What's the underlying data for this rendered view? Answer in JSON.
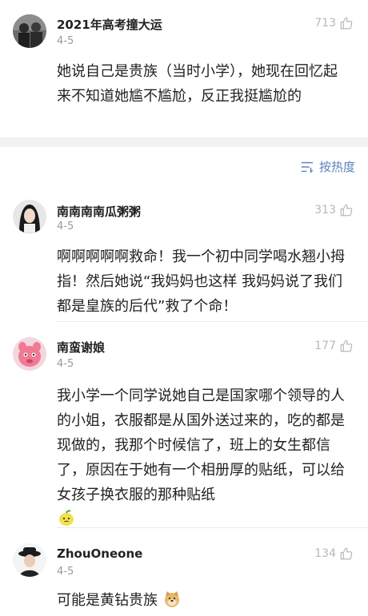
{
  "comments": [
    {
      "username": "2021年高考撞大运",
      "date": "4-5",
      "likes": "713",
      "text": "她说自己是贵族（当时小学），她现在回忆起来不知道她尴不尴尬，反正我挺尴尬的",
      "avatar": "two-people-photo-avatar"
    },
    {
      "username": "南南南南瓜粥粥",
      "date": "4-5",
      "likes": "313",
      "text": "啊啊啊啊啊救命！我一个初中同学喝水翘小拇指！然后她说“我妈妈也这样 我妈妈说了我们都是皇族的后代”救了个命！",
      "avatar": "girl-portrait-avatar"
    },
    {
      "username": "南蛮谢娘",
      "date": "4-5",
      "likes": "177",
      "text": "我小学一个同学说她自己是国家哪个领导的人的小姐，衣服都是从国外送过来的，吃的都是现做的，我那个时候信了，班上的女生都信了，原因在于她有一个相册厚的贴纸，可以给女孩子换衣服的那种贴纸",
      "emoji": "lemon-face-emoji",
      "avatar": "pink-cartoon-avatar"
    },
    {
      "username": "ZhouOneone",
      "date": "4-5",
      "likes": "134",
      "text": "可能是黄钻贵族",
      "emoji": "doge-emoji",
      "avatar": "hat-person-avatar"
    }
  ],
  "sort": {
    "label": "按热度",
    "icon": "sort-lines-icon"
  },
  "colors": {
    "username": "#222222",
    "meta": "#9a9a9a",
    "sort_link": "#5b83b9",
    "band": "#f2f2f2"
  }
}
